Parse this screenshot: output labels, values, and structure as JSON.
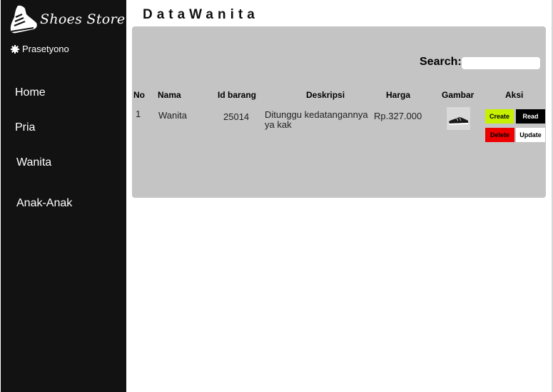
{
  "brand": {
    "name": "Shoes Store",
    "logo_icon": "shoe-icon"
  },
  "user": {
    "name": "Prasetyono",
    "icon": "user-gear-icon"
  },
  "nav": {
    "items": [
      {
        "label": "Home"
      },
      {
        "label": "Pria"
      },
      {
        "label": "Wanita"
      },
      {
        "label": "Anak-Anak"
      }
    ]
  },
  "page": {
    "title": "DataWanita"
  },
  "search": {
    "label": "Search:",
    "value": ""
  },
  "table": {
    "headers": [
      "No",
      "Nama",
      "Id barang",
      "Deskripsi",
      "Harga",
      "Gambar",
      "Aksi"
    ],
    "rows": [
      {
        "no": "1",
        "nama": "Wanita",
        "id_barang": "25014",
        "deskripsi": "Ditunggu kedatangannya ya kak",
        "harga": "Rp.327.000",
        "gambar": "shoe-thumbnail"
      }
    ]
  },
  "actions": {
    "create": "Create",
    "read": "Read",
    "delete": "Delete",
    "update": "Update"
  },
  "colors": {
    "sidebar": "#121212",
    "panel": "#c4c4c4",
    "create": "#c6f000",
    "read": "#000000",
    "delete": "#ee0000",
    "update": "#ffffff"
  }
}
